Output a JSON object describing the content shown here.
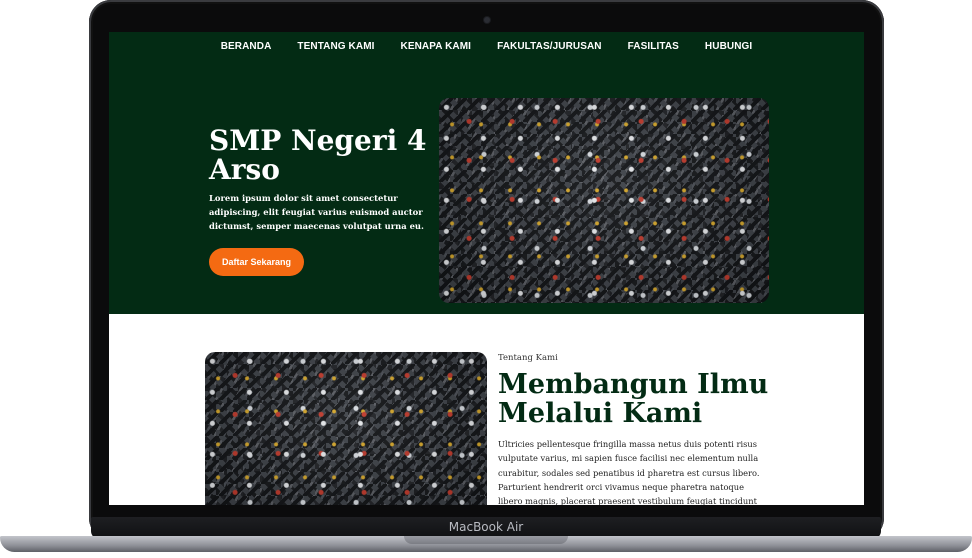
{
  "device": {
    "label": "MacBook Air"
  },
  "nav": {
    "items": [
      {
        "label": "BERANDA"
      },
      {
        "label": "TENTANG KAMI"
      },
      {
        "label": "KENAPA KAMI"
      },
      {
        "label": "FAKULTAS/JURUSAN"
      },
      {
        "label": "FASILITAS"
      },
      {
        "label": "HUBUNGI"
      }
    ]
  },
  "hero": {
    "title": "SMP Negeri 4 Arso",
    "description": "Lorem ipsum dolor sit amet consectetur adipiscing, elit feugiat varius euismod auctor dictumst, semper maecenas volutpat urna eu.",
    "cta_label": "Daftar Sekarang",
    "image_icon": "graduation-crowd-photo"
  },
  "about": {
    "kicker": "Tentang Kami",
    "title": "Membangun Ilmu Melalui Kami",
    "description": "Ultricies pellentesque fringilla massa netus duis potenti risus vulputate varius, mi sapien fusce facilisi nec elementum nulla curabitur, sodales sed penatibus id pharetra est cursus libero. Parturient hendrerit orci vivamus neque pharetra natoque libero magnis, placerat praesent vestibulum feugiat tincidunt ut quam.",
    "image_icon": "graduation-crowd-photo"
  },
  "colors": {
    "primary_green": "#032b14",
    "accent_orange": "#f46a12",
    "text_light": "#ffffff"
  }
}
